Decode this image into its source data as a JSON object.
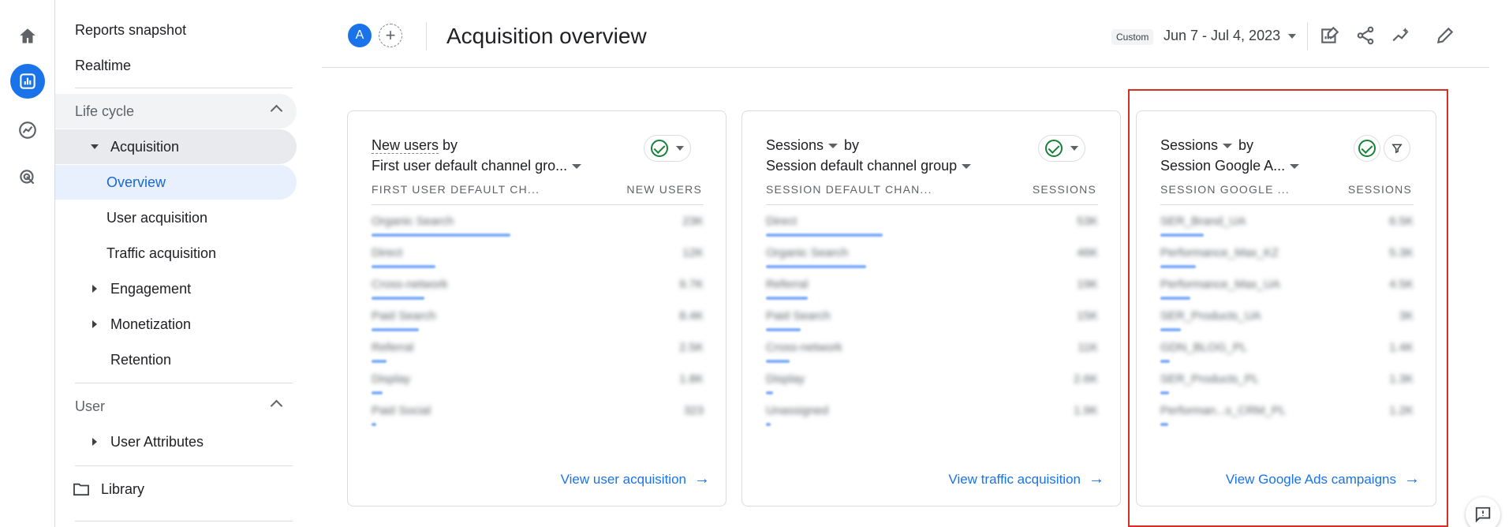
{
  "sidebar": {
    "reports_snapshot": "Reports snapshot",
    "realtime": "Realtime",
    "lifecycle": "Life cycle",
    "acquisition": "Acquisition",
    "overview": "Overview",
    "user_acquisition": "User acquisition",
    "traffic_acquisition": "Traffic acquisition",
    "engagement": "Engagement",
    "monetization": "Monetization",
    "retention": "Retention",
    "user": "User",
    "user_attributes": "User Attributes",
    "library": "Library"
  },
  "header": {
    "avatar_letter": "A",
    "title": "Acquisition overview",
    "custom_label": "Custom",
    "date_range": "Jun 7 - Jul 4, 2023"
  },
  "cards": [
    {
      "metric": "New users",
      "by": "by",
      "dimension": "First user default channel gro...",
      "col_dim": "FIRST USER DEFAULT CH...",
      "col_metric": "NEW USERS",
      "link": "View user acquisition",
      "rows": [
        {
          "label": "Organic Search",
          "value": "23K",
          "bar": 1.0
        },
        {
          "label": "Direct",
          "value": "12K",
          "bar": 0.46
        },
        {
          "label": "Cross-network",
          "value": "9.7K",
          "bar": 0.38
        },
        {
          "label": "Paid Search",
          "value": "8.4K",
          "bar": 0.34
        },
        {
          "label": "Referral",
          "value": "2.5K",
          "bar": 0.11
        },
        {
          "label": "Display",
          "value": "1.8K",
          "bar": 0.08
        },
        {
          "label": "Paid Social",
          "value": "323",
          "bar": 0.02
        }
      ]
    },
    {
      "metric": "Sessions",
      "by": "by",
      "dimension": "Session default channel group",
      "col_dim": "SESSION DEFAULT CHAN...",
      "col_metric": "SESSIONS",
      "link": "View traffic acquisition",
      "rows": [
        {
          "label": "Direct",
          "value": "53K",
          "bar": 1.0
        },
        {
          "label": "Organic Search",
          "value": "46K",
          "bar": 0.86
        },
        {
          "label": "Referral",
          "value": "19K",
          "bar": 0.36
        },
        {
          "label": "Paid Search",
          "value": "15K",
          "bar": 0.3
        },
        {
          "label": "Cross-network",
          "value": "11K",
          "bar": 0.2
        },
        {
          "label": "Display",
          "value": "2.6K",
          "bar": 0.06
        },
        {
          "label": "Unassigned",
          "value": "1.9K",
          "bar": 0.04
        }
      ]
    },
    {
      "metric": "Sessions",
      "by": "by",
      "dimension": "Session Google A...",
      "col_dim": "SESSION GOOGLE ...",
      "col_metric": "SESSIONS",
      "link": "View Google Ads campaigns",
      "rows": [
        {
          "label": "SER_Brand_UA",
          "value": "6.5K",
          "bar": 0.55
        },
        {
          "label": "Performance_Max_KZ",
          "value": "5.3K",
          "bar": 0.45
        },
        {
          "label": "Performance_Max_UA",
          "value": "4.5K",
          "bar": 0.38
        },
        {
          "label": "SER_Products_UA",
          "value": "3K",
          "bar": 0.26
        },
        {
          "label": "GDN_BLOG_PL",
          "value": "1.4K",
          "bar": 0.12
        },
        {
          "label": "SER_Products_PL",
          "value": "1.3K",
          "bar": 0.11
        },
        {
          "label": "Performan...s_CRM_PL",
          "value": "1.2K",
          "bar": 0.1
        }
      ]
    }
  ]
}
